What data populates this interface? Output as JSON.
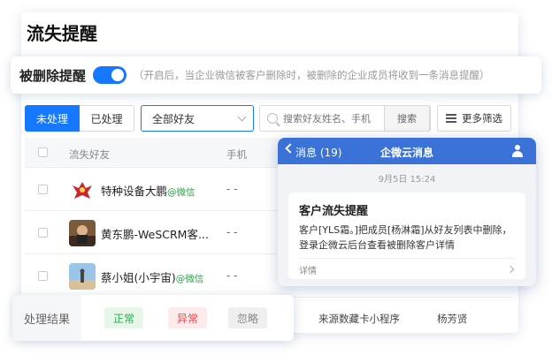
{
  "page": {
    "title": "流失提醒"
  },
  "reminder": {
    "label": "被删除提醒",
    "enabled": true,
    "hint": "（开启后，当企业微信被客户删除时，被删除的企业成员将收到一条消息提醒）"
  },
  "tabs": [
    {
      "label": "未处理",
      "active": true
    },
    {
      "label": "已处理",
      "active": false
    }
  ],
  "filter": {
    "selected": "全部好友"
  },
  "search": {
    "placeholder": "搜索好友姓名、手机",
    "button": "搜索"
  },
  "more_filter": {
    "label": "更多筛选"
  },
  "table": {
    "columns": {
      "friend": "流失好友",
      "phone": "手机"
    },
    "rows": [
      {
        "name": "特种设备大鹏",
        "tag": "@微信",
        "phone": "- -"
      },
      {
        "name": "黄东鹏-WeSCRM客...",
        "tag": "",
        "phone": "- -"
      },
      {
        "name": "蔡小姐(小宇宙)",
        "tag": "@微信",
        "phone": "- -"
      }
    ],
    "bottom_row": {
      "source": "来源数藏卡小程序",
      "owner": "杨芳贤"
    }
  },
  "message": {
    "back_label": "消息 (19)",
    "app_title": "企微云消息",
    "time": "9月5日 15:24",
    "title": "客户流失提醒",
    "text": "客户[YLS霜。]把成员[杨淋霜]从好友列表中删除，登录企微云后台查看被删除客户详情",
    "more": "详情"
  },
  "result": {
    "label": "处理结果",
    "tags": {
      "ok": "正常",
      "err": "异常",
      "ignore": "忽略"
    }
  },
  "colors": {
    "accent": "#1677ff",
    "wechat_green": "#2ba245",
    "header_blue": "#3a72d8"
  }
}
